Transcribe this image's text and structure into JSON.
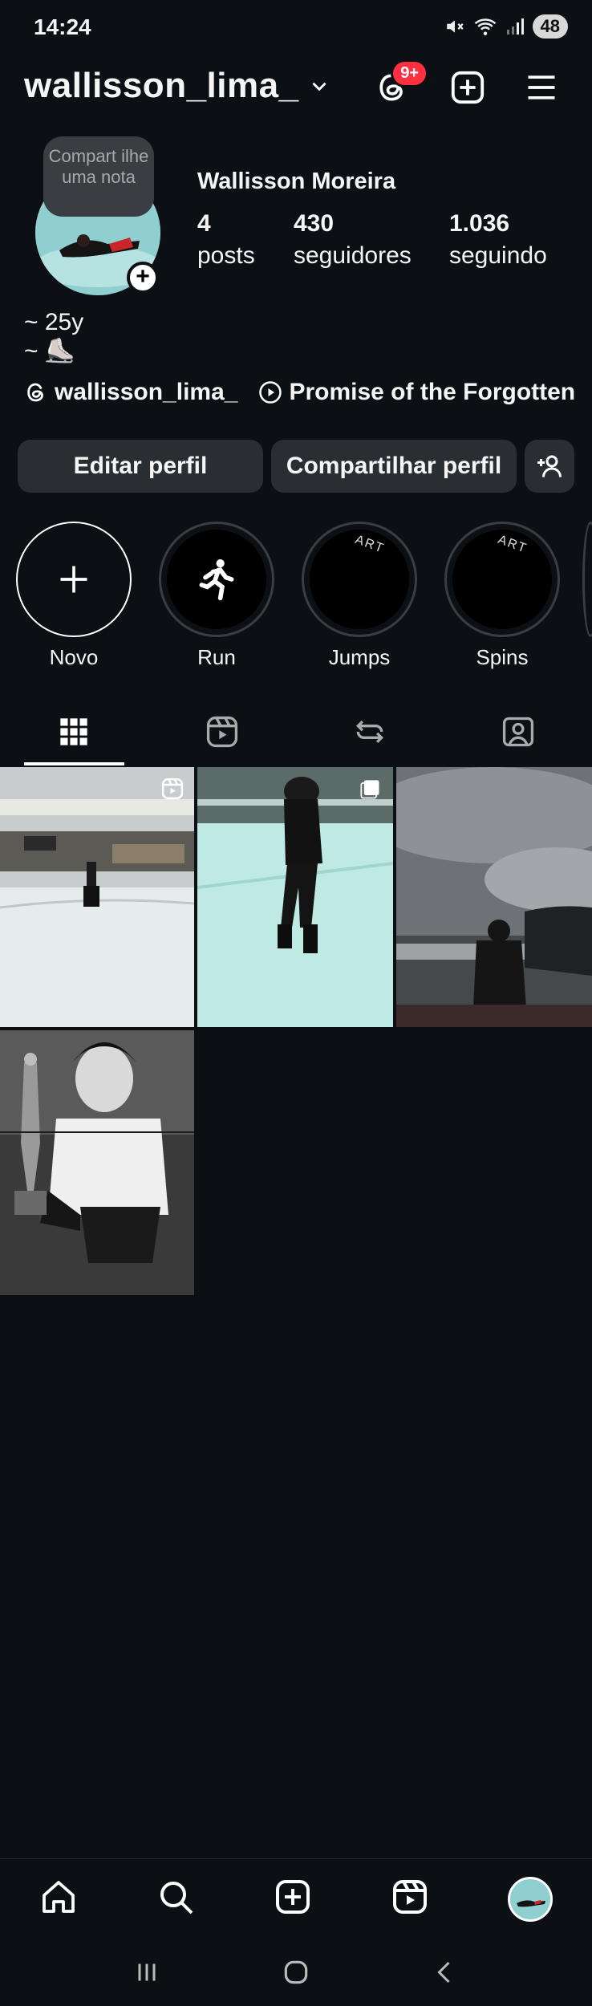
{
  "status": {
    "time": "14:24",
    "battery": "48"
  },
  "header": {
    "username": "wallisson_lima_",
    "threads_badge": "9+"
  },
  "profile": {
    "note": "Compart ilhe uma nota",
    "full_name": "Wallisson Moreira",
    "stats": [
      {
        "value": "4",
        "label": "posts"
      },
      {
        "value": "430",
        "label": "seguidores"
      },
      {
        "value": "1.036",
        "label": "seguindo"
      }
    ],
    "bio_lines": [
      "~ 25y",
      "~ ⛸️"
    ],
    "threads_handle": "wallisson_lima_",
    "music": "Promise of the Forgotten"
  },
  "buttons": {
    "edit": "Editar perfil",
    "share": "Compartilhar perfil"
  },
  "highlights": [
    {
      "label": "Novo",
      "icon": "plus-icon"
    },
    {
      "label": "Run",
      "icon": "running-person-icon"
    },
    {
      "label": "Jumps",
      "icon": "art-text",
      "text": "ART"
    },
    {
      "label": "Spins",
      "icon": "art-text",
      "text": "ART"
    }
  ],
  "tabs": [
    "grid-icon",
    "reels-icon",
    "reposts-icon",
    "tagged-icon"
  ],
  "posts": [
    {
      "kind": "reel",
      "scene": "ice-rink-mall"
    },
    {
      "kind": "carousel",
      "scene": "skater-on-ice"
    },
    {
      "kind": "image",
      "scene": "cloudy-sky-lake"
    },
    {
      "kind": "image",
      "scene": "trophy-portrait"
    }
  ],
  "bottom_nav": [
    "home-icon",
    "search-icon",
    "create-icon",
    "reels-icon",
    "profile-avatar"
  ],
  "colors": {
    "background": "#0c1014",
    "button": "#2a2e33",
    "badge": "#ff3040",
    "avatar_bg": "#8fcfcf"
  }
}
